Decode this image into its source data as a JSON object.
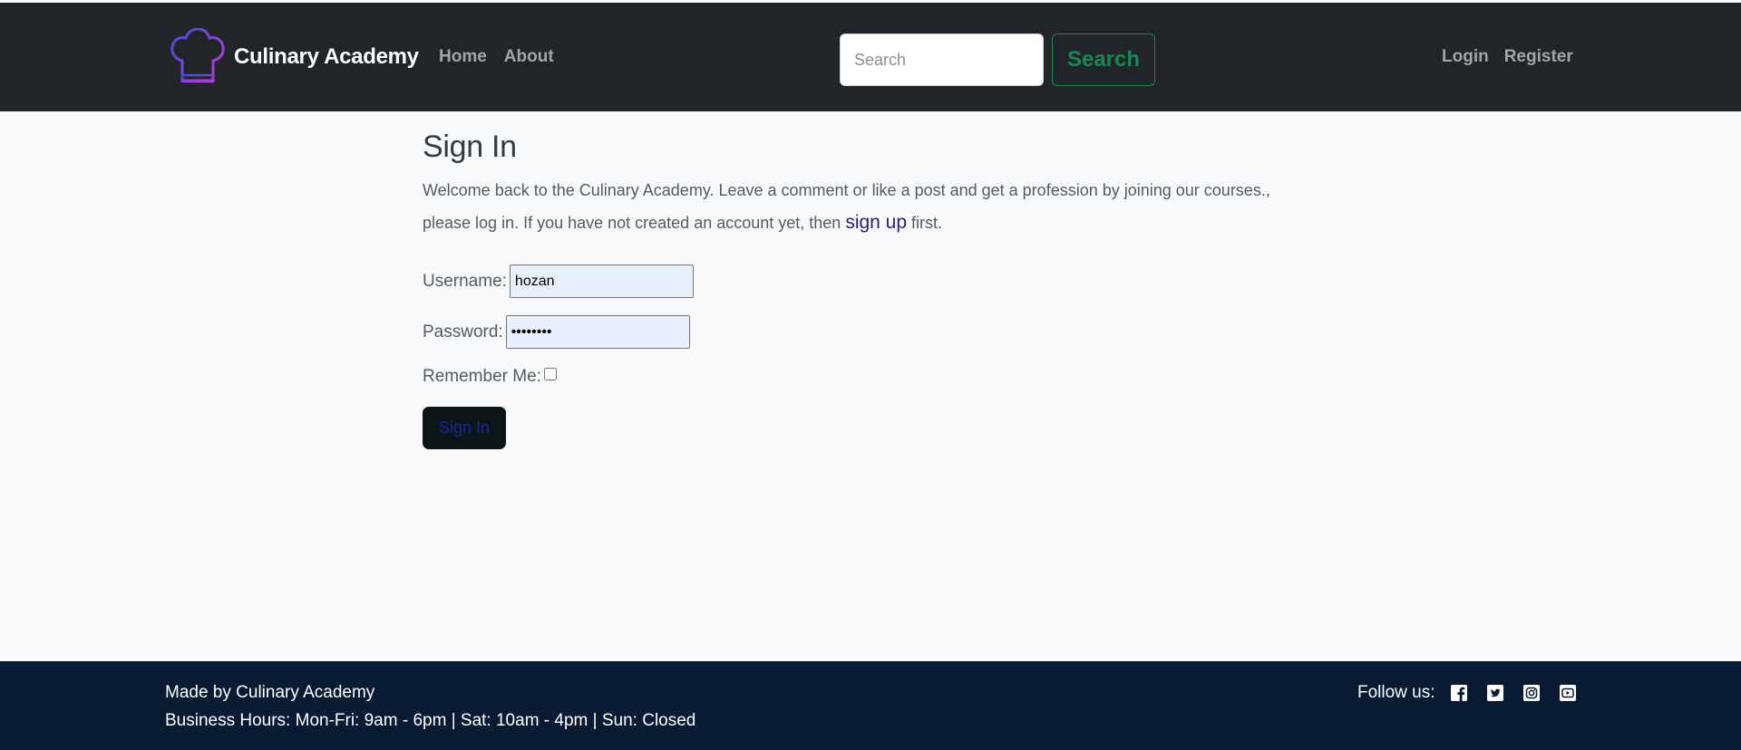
{
  "brand": {
    "name": "Culinary Academy"
  },
  "nav": {
    "home": "Home",
    "about": "About",
    "search_placeholder": "Search",
    "search_button": "Search",
    "login": "Login",
    "register": "Register"
  },
  "main": {
    "title": "Sign In",
    "intro_part1": "Welcome back to the Culinary Academy. Leave a comment or like a post and get a profession by joining our courses., please log in. If you have not created an account yet, then ",
    "signup_link": "sign up",
    "intro_part2": " first.",
    "form": {
      "username_label": "Username:",
      "username_value": "hozan",
      "password_label": "Password:",
      "password_value": "hozan123",
      "remember_label": "Remember Me:",
      "remember_checked": false,
      "submit_label": "Sign In"
    }
  },
  "footer": {
    "made_by": "Made by Culinary Academy",
    "hours": "Business Hours: Mon-Fri: 9am - 6pm | Sat: 10am - 4pm | Sun: Closed",
    "follow_label": "Follow us:",
    "social_icons": [
      "facebook-icon",
      "twitter-icon",
      "instagram-icon",
      "youtube-icon"
    ]
  },
  "colors": {
    "navbar_bg": "#212529",
    "footer_bg": "#081b33",
    "search_accent": "#198754",
    "logo_gradient": [
      "#3b4fd8",
      "#c23ad8"
    ]
  }
}
